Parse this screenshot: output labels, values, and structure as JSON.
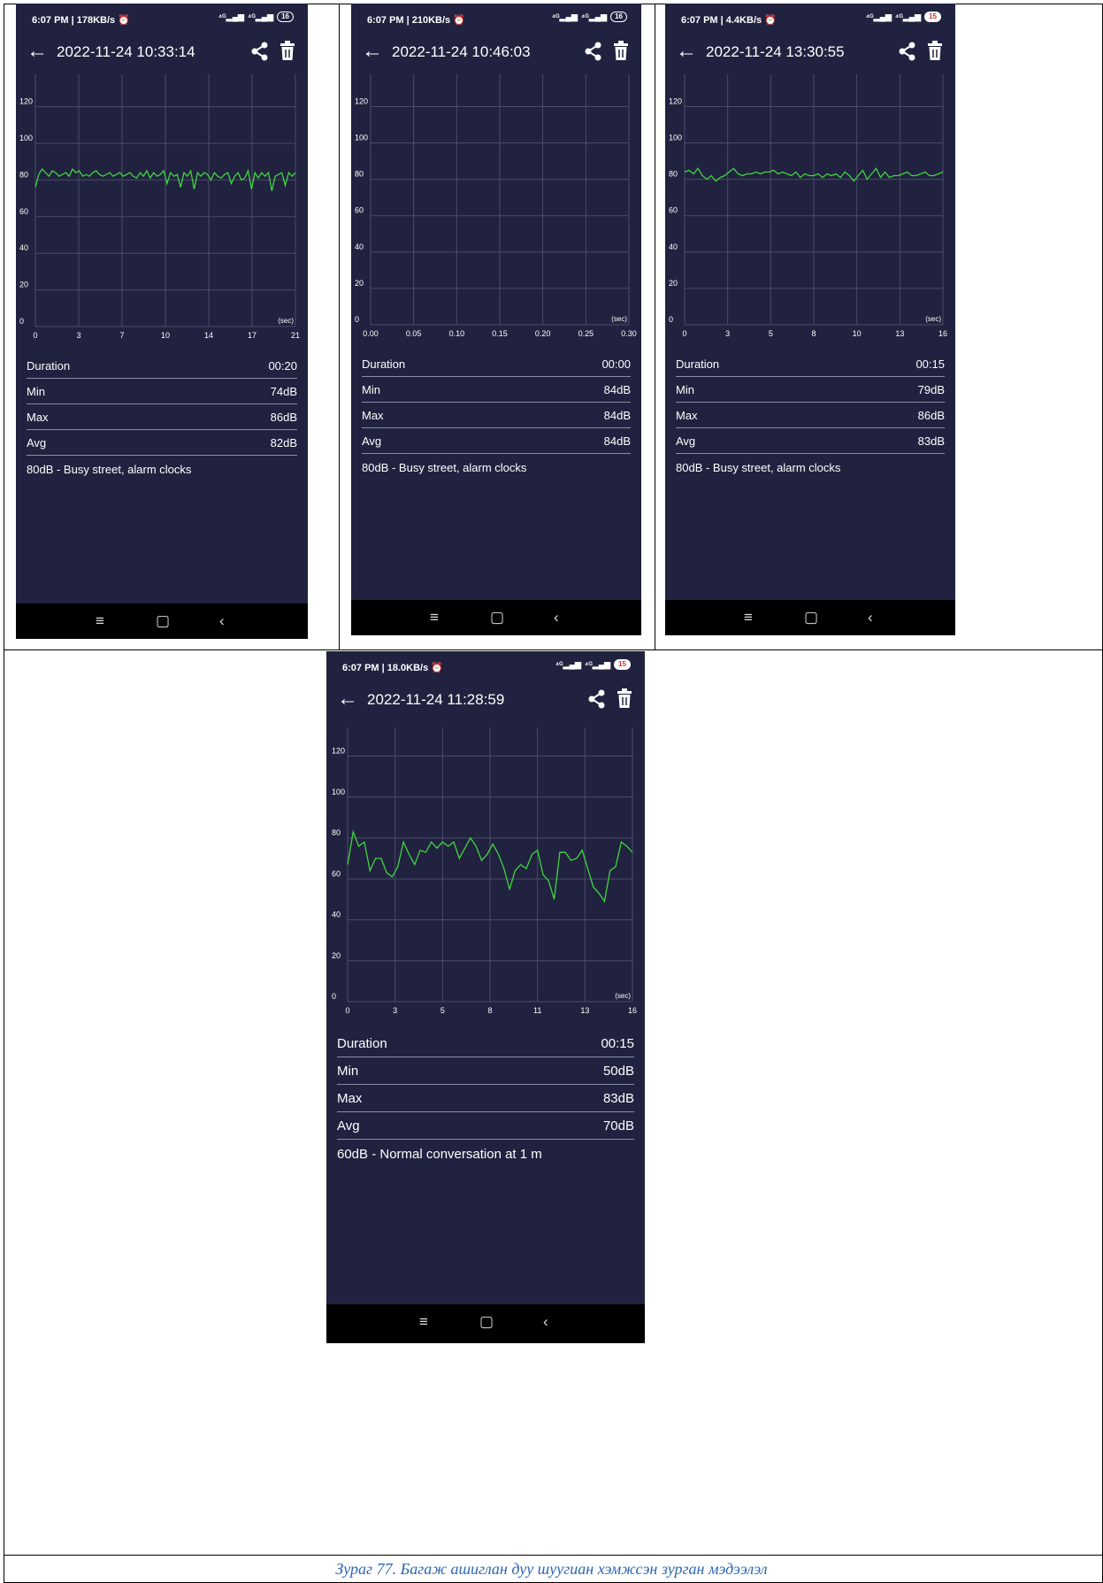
{
  "caption": "Зураг 77. Багаж ашиглан дуу шуугиан хэмжсэн зурган мэдээлэл",
  "colors": {
    "bg": "#21223f",
    "line": "#3fd63f",
    "grid": "#4a4c68"
  },
  "icons": {
    "back": "arrow-left-icon",
    "share": "share-icon",
    "delete": "trash-icon"
  },
  "screens": [
    {
      "status_time": "6:07 PM | 178KB/s ⏰",
      "battery": "16",
      "title": "2022-11-24 10:33:14",
      "stats": {
        "duration_label": "Duration",
        "duration": "00:20",
        "min_label": "Min",
        "min": "74dB",
        "max_label": "Max",
        "max": "86dB",
        "avg_label": "Avg",
        "avg": "82dB"
      },
      "reference": "80dB - Busy street, alarm clocks"
    },
    {
      "status_time": "6:07 PM | 210KB/s ⏰",
      "battery": "16",
      "title": "2022-11-24 10:46:03",
      "stats": {
        "duration_label": "Duration",
        "duration": "00:00",
        "min_label": "Min",
        "min": "84dB",
        "max_label": "Max",
        "max": "84dB",
        "avg_label": "Avg",
        "avg": "84dB"
      },
      "reference": "80dB - Busy street, alarm clocks"
    },
    {
      "status_time": "6:07 PM | 4.4KB/s ⏰",
      "battery": "15",
      "title": "2022-11-24 13:30:55",
      "stats": {
        "duration_label": "Duration",
        "duration": "00:15",
        "min_label": "Min",
        "min": "79dB",
        "max_label": "Max",
        "max": "86dB",
        "avg_label": "Avg",
        "avg": "83dB"
      },
      "reference": "80dB - Busy street, alarm clocks"
    },
    {
      "status_time": "6:07 PM | 18.0KB/s ⏰",
      "battery": "15",
      "title": "2022-11-24 11:28:59",
      "stats": {
        "duration_label": "Duration",
        "duration": "00:15",
        "min_label": "Min",
        "min": "50dB",
        "max_label": "Max",
        "max": "83dB",
        "avg_label": "Avg",
        "avg": "70dB"
      },
      "reference": "60dB - Normal conversation at 1 m"
    }
  ],
  "chart_data": [
    {
      "type": "line",
      "xlabel": "(sec)",
      "ylabel": "",
      "x_ticks": [
        "0",
        "3",
        "7",
        "10",
        "14",
        "17",
        "21"
      ],
      "x_range": [
        0,
        21
      ],
      "y_ticks": [
        "0",
        "20",
        "40",
        "60",
        "80",
        "100",
        "120"
      ],
      "ylim": [
        0,
        128
      ],
      "series": [
        {
          "values": [
            76,
            83,
            86,
            84,
            82,
            85,
            84,
            82,
            83,
            84,
            82,
            86,
            84,
            85,
            82,
            83,
            82,
            84,
            85,
            83,
            82,
            83,
            84,
            82,
            83,
            84,
            82,
            83,
            84,
            82,
            81,
            84,
            82,
            85,
            81,
            84,
            82,
            83,
            85,
            78,
            84,
            82,
            83,
            76,
            84,
            82,
            85,
            75,
            84,
            82,
            84,
            83,
            80,
            84,
            82,
            81,
            83,
            84,
            78,
            82,
            84,
            80,
            81,
            85,
            75,
            84,
            81,
            84,
            82,
            84,
            74,
            82,
            83,
            84,
            77,
            84,
            82,
            84
          ]
        }
      ]
    },
    {
      "type": "line",
      "xlabel": "(sec)",
      "ylabel": "",
      "x_ticks": [
        "0.00",
        "0.05",
        "0.10",
        "0.15",
        "0.20",
        "0.25",
        "0.30"
      ],
      "x_range": [
        0,
        0.3
      ],
      "y_ticks": [
        "0",
        "20",
        "40",
        "60",
        "80",
        "100",
        "120"
      ],
      "ylim": [
        0,
        128
      ],
      "series": [
        {
          "values": []
        }
      ]
    },
    {
      "type": "line",
      "xlabel": "(sec)",
      "ylabel": "",
      "x_ticks": [
        "0",
        "3",
        "5",
        "8",
        "10",
        "13",
        "16"
      ],
      "x_range": [
        0,
        16
      ],
      "y_ticks": [
        "0",
        "20",
        "40",
        "60",
        "80",
        "100",
        "120"
      ],
      "ylim": [
        0,
        128
      ],
      "series": [
        {
          "values": [
            84,
            85,
            83,
            86,
            82,
            80,
            82,
            79,
            81,
            82,
            84,
            86,
            83,
            82,
            83,
            83,
            84,
            83,
            84,
            84,
            85,
            83,
            84,
            83,
            82,
            84,
            81,
            83,
            82,
            82,
            83,
            81,
            83,
            82,
            83,
            81,
            84,
            82,
            79,
            82,
            85,
            80,
            83,
            86,
            81,
            84,
            81,
            82,
            82,
            83,
            84,
            82,
            82,
            83,
            84,
            82,
            82,
            83,
            84
          ]
        }
      ]
    },
    {
      "type": "line",
      "xlabel": "(sec)",
      "ylabel": "",
      "x_ticks": [
        "0",
        "3",
        "5",
        "8",
        "11",
        "13",
        "16"
      ],
      "x_range": [
        0,
        16
      ],
      "y_ticks": [
        "0",
        "20",
        "40",
        "60",
        "80",
        "100",
        "120"
      ],
      "ylim": [
        0,
        128
      ],
      "series": [
        {
          "values": [
            67,
            83,
            76,
            78,
            64,
            70,
            70,
            63,
            61,
            66,
            78,
            72,
            67,
            74,
            73,
            78,
            75,
            78,
            76,
            78,
            70,
            75,
            80,
            76,
            69,
            72,
            77,
            72,
            65,
            55,
            64,
            67,
            65,
            72,
            74,
            62,
            59,
            50,
            73,
            73,
            69,
            70,
            74,
            65,
            56,
            53,
            49,
            64,
            66,
            78,
            76,
            73
          ]
        }
      ]
    }
  ]
}
